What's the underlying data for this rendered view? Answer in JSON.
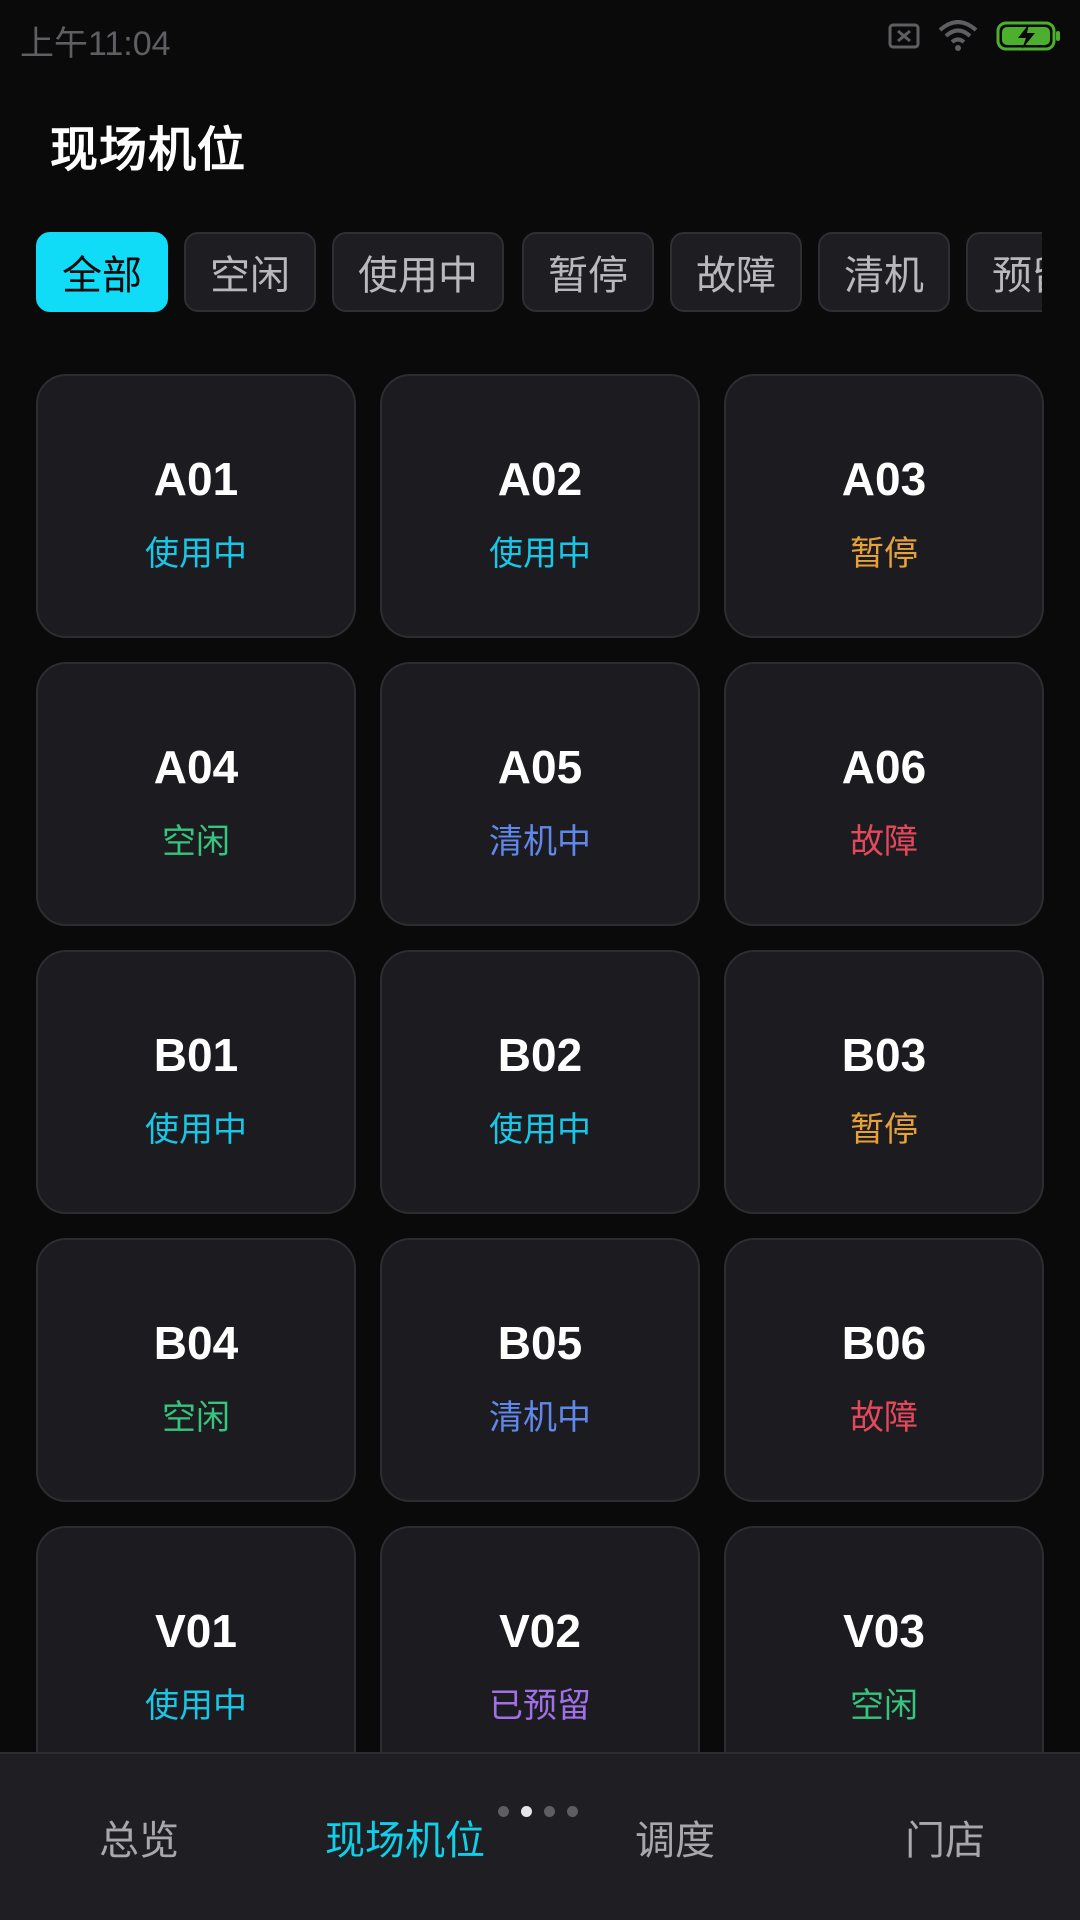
{
  "status_bar": {
    "time": "上午11:04",
    "icons": [
      "sim-off-icon",
      "wifi-icon",
      "battery-charging-icon"
    ],
    "battery_color": "#4caf2e"
  },
  "header": {
    "title": "现场机位"
  },
  "filters": {
    "items": [
      {
        "label": "全部",
        "active": true
      },
      {
        "label": "空闲",
        "active": false
      },
      {
        "label": "使用中",
        "active": false
      },
      {
        "label": "暂停",
        "active": false
      },
      {
        "label": "故障",
        "active": false
      },
      {
        "label": "清机",
        "active": false
      },
      {
        "label": "预留",
        "active": false
      }
    ],
    "active_color": "#10dcf8"
  },
  "status_colors": {
    "使用中": "#18c6e6",
    "暂停": "#e7a13a",
    "空闲": "#36c57f",
    "清机中": "#5f87ec",
    "故障": "#e5485b",
    "已预留": "#a070e8"
  },
  "machines": [
    {
      "name": "A01",
      "status": "使用中"
    },
    {
      "name": "A02",
      "status": "使用中"
    },
    {
      "name": "A03",
      "status": "暂停"
    },
    {
      "name": "A04",
      "status": "空闲"
    },
    {
      "name": "A05",
      "status": "清机中"
    },
    {
      "name": "A06",
      "status": "故障"
    },
    {
      "name": "B01",
      "status": "使用中"
    },
    {
      "name": "B02",
      "status": "使用中"
    },
    {
      "name": "B03",
      "status": "暂停"
    },
    {
      "name": "B04",
      "status": "空闲"
    },
    {
      "name": "B05",
      "status": "清机中"
    },
    {
      "name": "B06",
      "status": "故障"
    },
    {
      "name": "V01",
      "status": "使用中"
    },
    {
      "name": "V02",
      "status": "已预留"
    },
    {
      "name": "V03",
      "status": "空闲"
    }
  ],
  "bottom_nav": {
    "items": [
      {
        "label": "总览",
        "active": false
      },
      {
        "label": "现场机位",
        "active": true
      },
      {
        "label": "调度",
        "active": false
      },
      {
        "label": "门店",
        "active": false
      }
    ],
    "page_indicator": {
      "pages": 4,
      "current": 2
    }
  }
}
